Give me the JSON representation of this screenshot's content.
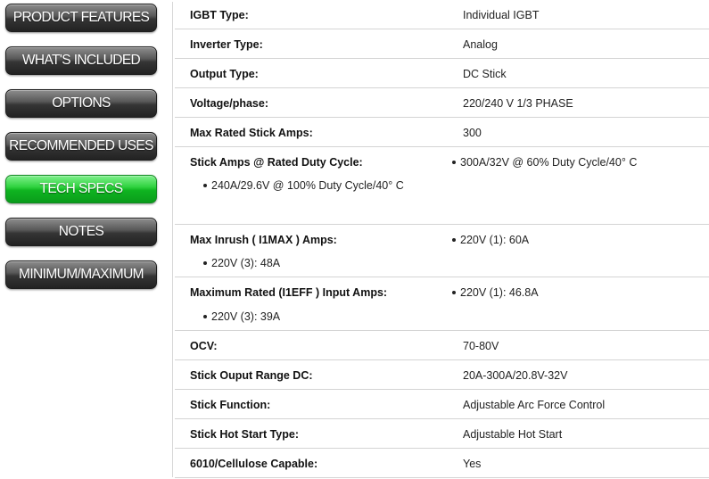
{
  "nav": [
    {
      "label": "PRODUCT FEATURES",
      "active": false
    },
    {
      "label": "WHAT'S INCLUDED",
      "active": false
    },
    {
      "label": "OPTIONS",
      "active": false
    },
    {
      "label": "RECOMMENDED USES",
      "active": false
    },
    {
      "label": "TECH SPECS",
      "active": true
    },
    {
      "label": "NOTES",
      "active": false
    },
    {
      "label": "MINIMUM/MAXIMUM",
      "active": false
    }
  ],
  "specs": [
    {
      "label": "IGBT Type:",
      "value": "Individual IGBT"
    },
    {
      "label": "Inverter Type:",
      "value": "Analog"
    },
    {
      "label": "Output Type:",
      "value": "DC Stick"
    },
    {
      "label": "Voltage/phase:",
      "value": "220/240 V 1/3 PHASE"
    },
    {
      "label": "Max Rated Stick Amps:",
      "value": "300"
    },
    {
      "label": "Stick Amps @ Rated Duty Cycle:",
      "bullets": [
        "300A/32V @ 60% Duty Cycle/40° C",
        "240A/29.6V @ 100% Duty Cycle/40° C"
      ]
    },
    {
      "label": "Max Inrush ( I1MAX ) Amps:",
      "bullets": [
        "220V (1): 60A",
        "220V (3): 48A"
      ]
    },
    {
      "label": "Maximum Rated (I1EFF ) Input Amps:",
      "bullets": [
        "220V (1): 46.8A",
        "220V (3): 39A"
      ]
    },
    {
      "label": "OCV:",
      "value": "70-80V"
    },
    {
      "label": "Stick Ouput Range DC:",
      "value": "20A-300A/20.8V-32V"
    },
    {
      "label": "Stick Function:",
      "value": "Adjustable Arc Force Control"
    },
    {
      "label": "Stick Hot Start Type:",
      "value": "Adjustable Hot Start"
    },
    {
      "label": "6010/Cellulose Capable:",
      "value": "Yes"
    }
  ]
}
